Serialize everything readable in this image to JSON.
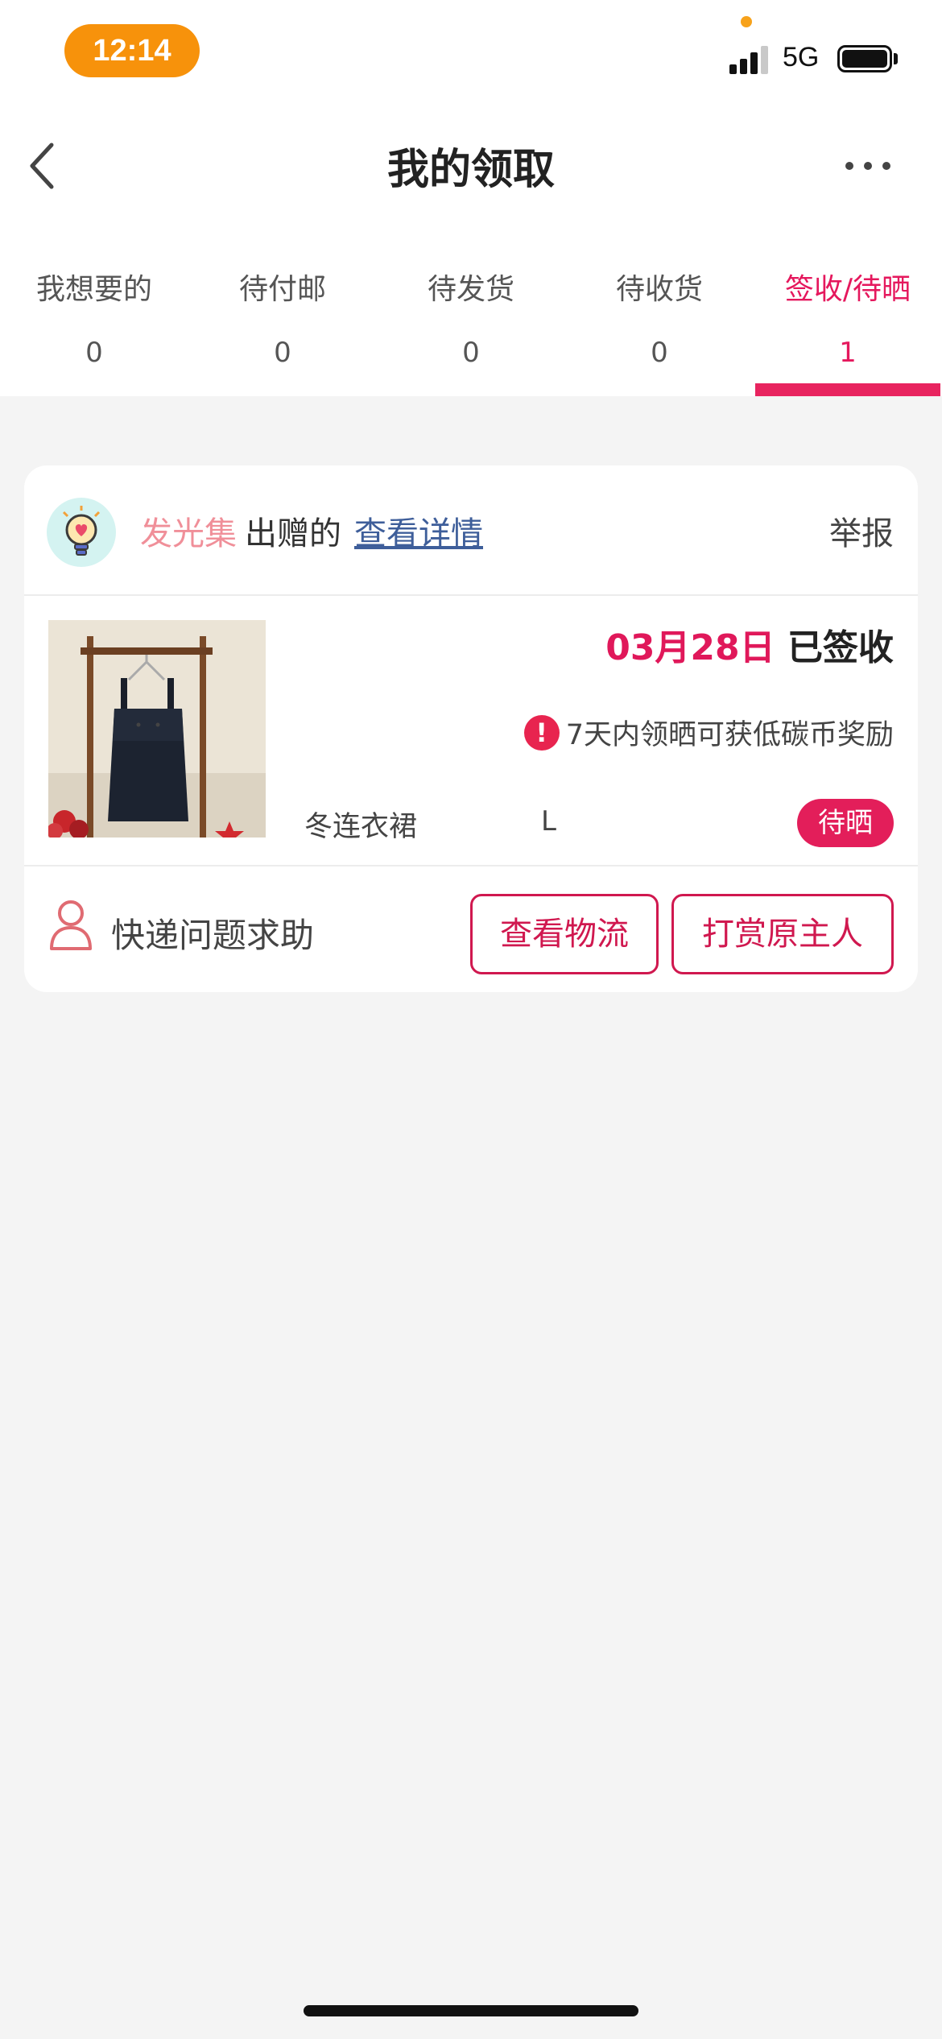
{
  "status_bar": {
    "time": "12:14",
    "network": "5G"
  },
  "header": {
    "title": "我的领取"
  },
  "tabs": [
    {
      "label": "我想要的",
      "count": "0"
    },
    {
      "label": "待付邮",
      "count": "0"
    },
    {
      "label": "待发货",
      "count": "0"
    },
    {
      "label": "待收货",
      "count": "0"
    },
    {
      "label": "签收/待晒",
      "count": "1"
    }
  ],
  "card": {
    "giver_name": "发光集",
    "giver_suffix": "出赠的",
    "detail_link": "查看详情",
    "report": "举报",
    "date": "03月28日",
    "status": "已签收",
    "reward_note": "7天内领晒可获低碳币奖励",
    "item_name": "冬连衣裙",
    "item_size": "L",
    "badge": "待晒",
    "help": "快递问题求助",
    "btn_logistics": "查看物流",
    "btn_reward": "打赏原主人"
  },
  "colors": {
    "accent": "#e5185d",
    "status_time": "#f7920b",
    "link": "#3e5e9a"
  }
}
